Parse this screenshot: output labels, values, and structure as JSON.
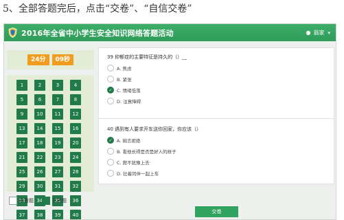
{
  "doc": {
    "caption": "5、全部答题完后，点击“交卷”、“自信交卷”"
  },
  "header": {
    "title": "2016年全省中小学生安全知识网络答题活动",
    "user": "翁家"
  },
  "timer": {
    "minutes": "24分",
    "seconds": "09秒"
  },
  "grid": {
    "numbers": [
      "1",
      "2",
      "3",
      "4",
      "5",
      "6",
      "7",
      "8",
      "9",
      "10",
      "11",
      "12",
      "13",
      "14",
      "15",
      "16",
      "17",
      "18",
      "19",
      "20",
      "21",
      "22",
      "23",
      "24",
      "25",
      "26",
      "27",
      "28",
      "29",
      "30",
      "31",
      "32",
      "33",
      "34",
      "35",
      "36",
      "37",
      "38",
      "39",
      "40"
    ]
  },
  "legend": {
    "unanswered": "未答题",
    "answered": "已答题"
  },
  "q39": {
    "text": "39  抑郁症的主要特征是持久的（）__",
    "options": [
      {
        "label": "A. 焦虑",
        "selected": false
      },
      {
        "label": "B. 紧张",
        "selected": false
      },
      {
        "label": "C. 情绪低落",
        "selected": true
      },
      {
        "label": "D. 注意障碍",
        "selected": false
      }
    ]
  },
  "q40": {
    "text": "40  遇到有人要求开车送你回家，你应该（）",
    "options": [
      {
        "label": "A. 婉言拒绝",
        "selected": true
      },
      {
        "label": "B. 看他长得是否是好人的样子",
        "selected": false
      },
      {
        "label": "C. 爬不犹豫上去",
        "selected": false
      },
      {
        "label": "D. 拉着同伴一起上车",
        "selected": false
      }
    ]
  },
  "actions": {
    "submit": "交卷"
  },
  "icons": {
    "logo": "shield-logo",
    "user": "user-icon",
    "caret": "caret-down-icon",
    "check": "check-icon"
  },
  "colors": {
    "header_green": "#2f9b59",
    "question_box": "#217a4a",
    "timer_orange": "#f29c1f",
    "panel_bg": "#e3ecd5"
  }
}
